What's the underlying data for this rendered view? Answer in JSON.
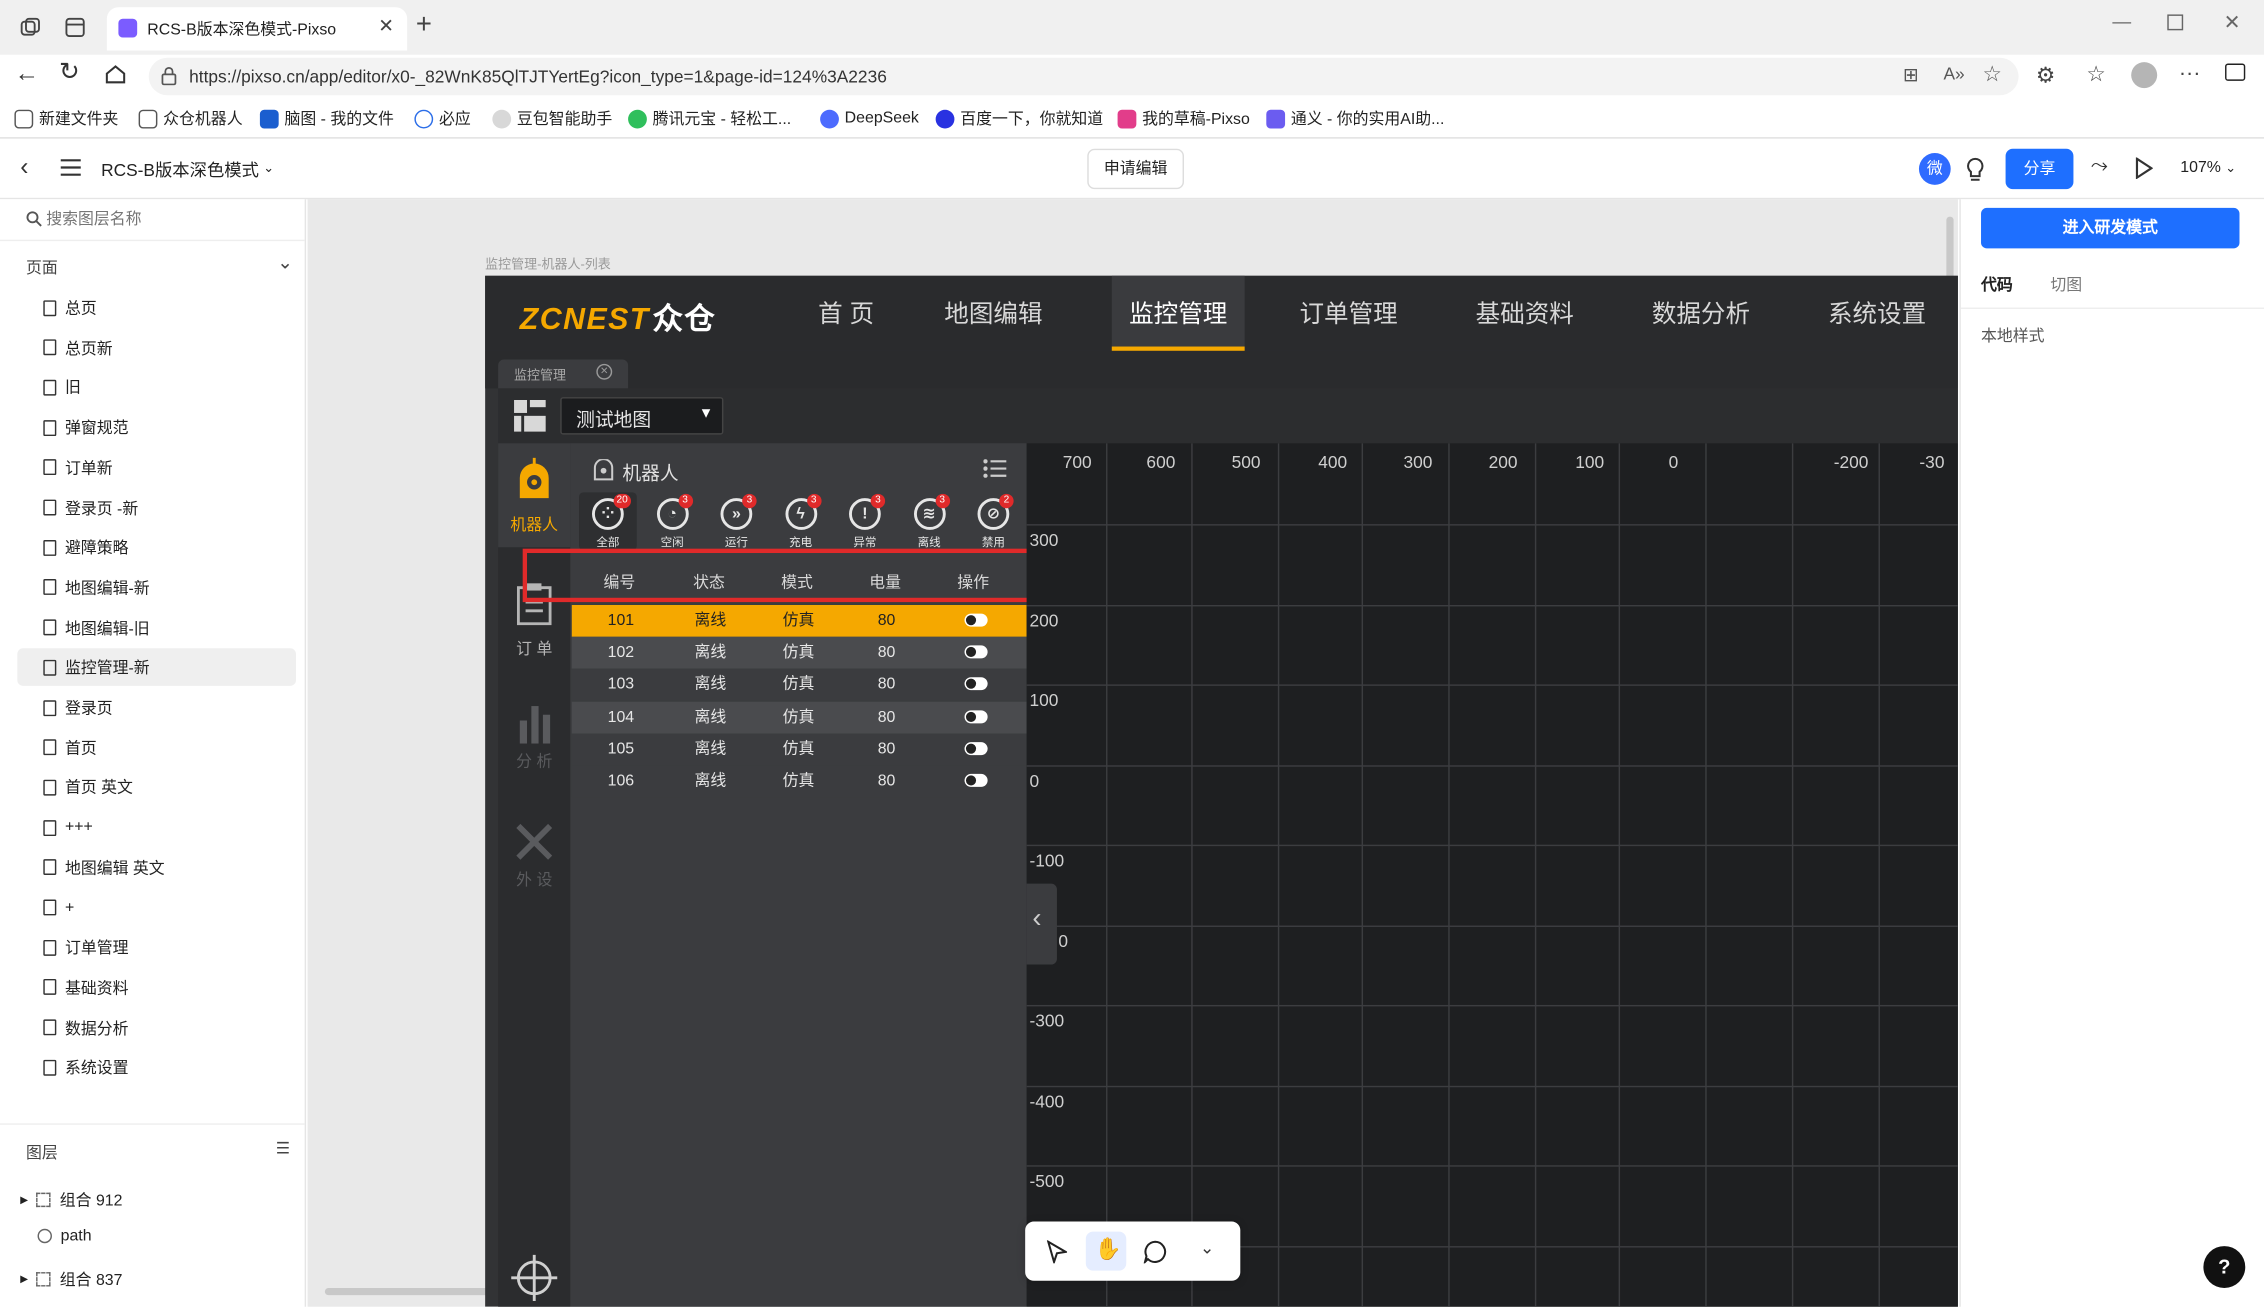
{
  "browser": {
    "tab_title": "RCS-B版本深色模式-Pixso",
    "url": "https://pixso.cn/app/editor/x0-_82WnK85QlTJTYertEg?icon_type=1&page-id=124%3A2236",
    "bookmarks": [
      "新建文件夹",
      "众仓机器人",
      "脑图 - 我的文件",
      "必应",
      "豆包智能助手",
      "腾讯元宝 - 轻松工...",
      "DeepSeek",
      "百度一下，你就知道",
      "我的草稿-Pixso",
      "通义 - 你的实用AI助..."
    ]
  },
  "editor": {
    "file_name": "RCS-B版本深色模式",
    "request_edit": "申请编辑",
    "avatar_char": "微",
    "share": "分享",
    "zoom": "107%",
    "search_placeholder": "搜索图层名称",
    "pages_label": "页面",
    "pages": [
      "总页",
      "总页新",
      "旧",
      "弹窗规范",
      "订单新",
      "登录页 -新",
      "避障策略",
      "地图编辑-新",
      "地图编辑-旧",
      "监控管理-新",
      "登录页",
      "首页",
      "首页 英文",
      "+++",
      "地图编辑 英文",
      "+",
      "订单管理",
      "基础资料",
      "数据分析",
      "系统设置"
    ],
    "selected_page_index": 9,
    "layers_label": "图层",
    "layers": [
      "组合 912",
      "path",
      "组合 837"
    ],
    "dev_mode_button": "进入研发模式",
    "right_tabs": [
      "代码",
      "切图"
    ],
    "local_styles": "本地样式",
    "frame_label": "监控管理-机器人-列表",
    "help": "?"
  },
  "design": {
    "logo_text": "ZCNEST",
    "logo_cn": "众仓",
    "nav": [
      "首 页",
      "地图编辑",
      "监控管理",
      "订单管理",
      "基础资料",
      "数据分析",
      "系统设置"
    ],
    "active_nav_index": 2,
    "subtab": "监控管理",
    "map_select": "测试地图",
    "side_menu": [
      "机器人",
      "订 单",
      "分 析",
      "外 设"
    ],
    "robot_title": "机器人",
    "filters": [
      {
        "label": "全部",
        "count": "20"
      },
      {
        "label": "空闲",
        "count": "3"
      },
      {
        "label": "运行",
        "count": "3"
      },
      {
        "label": "充电",
        "count": "3"
      },
      {
        "label": "异常",
        "count": "3"
      },
      {
        "label": "离线",
        "count": "3"
      },
      {
        "label": "禁用",
        "count": "2"
      }
    ],
    "table_headers": [
      "编号",
      "状态",
      "模式",
      "电量",
      "操作"
    ],
    "rows": [
      {
        "id": "101",
        "status": "离线",
        "mode": "仿真",
        "battery": "80"
      },
      {
        "id": "102",
        "status": "离线",
        "mode": "仿真",
        "battery": "80"
      },
      {
        "id": "103",
        "status": "离线",
        "mode": "仿真",
        "battery": "80"
      },
      {
        "id": "104",
        "status": "离线",
        "mode": "仿真",
        "battery": "80"
      },
      {
        "id": "105",
        "status": "离线",
        "mode": "仿真",
        "battery": "80"
      },
      {
        "id": "106",
        "status": "离线",
        "mode": "仿真",
        "battery": "80"
      }
    ],
    "x_ticks": [
      "700",
      "600",
      "500",
      "400",
      "300",
      "200",
      "100",
      "0",
      "-200",
      "-30"
    ],
    "y_ticks": [
      "300",
      "200",
      "100",
      "0",
      "-100",
      "0",
      "-300",
      "-400",
      "-500"
    ]
  },
  "colors": {
    "accent": "#1e6fff",
    "orange": "#f5a800",
    "highlight_box": "#e02a2a"
  }
}
